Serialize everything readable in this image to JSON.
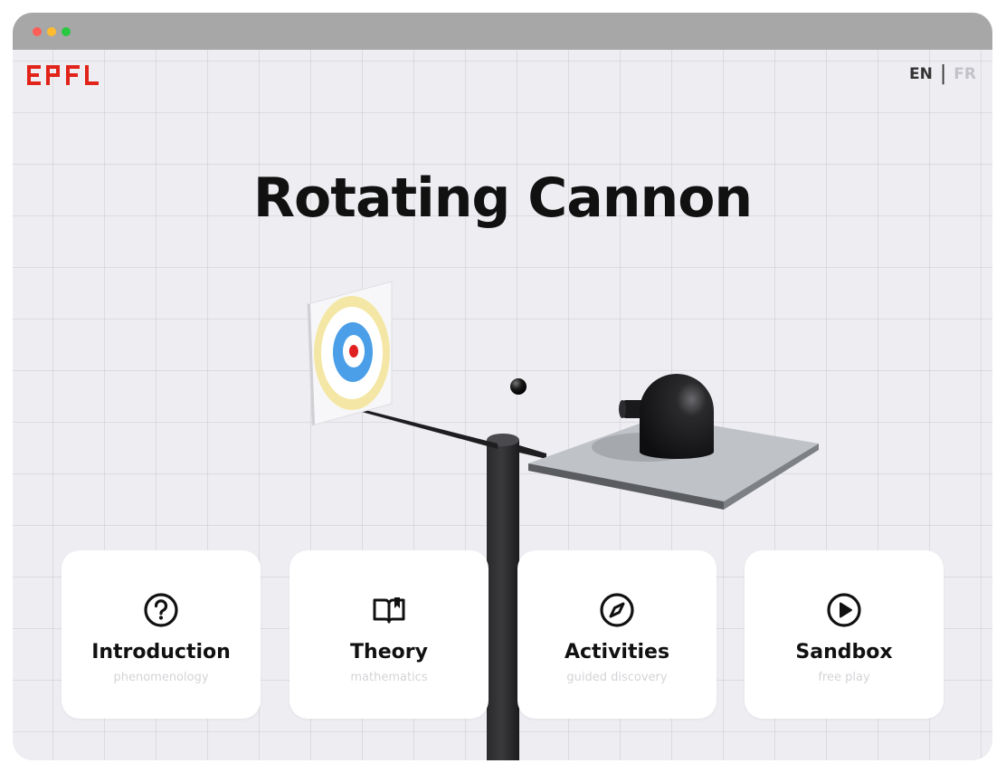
{
  "app": {
    "logo_text": "EPFL",
    "title": "Rotating Cannon"
  },
  "language": {
    "active": "EN",
    "separator": "|",
    "inactive": "FR"
  },
  "cards": [
    {
      "title": "Introduction",
      "subtitle": "phenomenology",
      "icon": "question-circle-icon"
    },
    {
      "title": "Theory",
      "subtitle": "mathematics",
      "icon": "open-book-icon"
    },
    {
      "title": "Activities",
      "subtitle": "guided discovery",
      "icon": "compass-icon"
    },
    {
      "title": "Sandbox",
      "subtitle": "free play",
      "icon": "play-circle-icon"
    }
  ],
  "colors": {
    "brand_red": "#e2231a",
    "background": "#eeeef2",
    "titlebar": "#a7a7a7",
    "target_outer": "#f4e7a6",
    "target_middle": "#4a9fe8",
    "target_center": "#e02020"
  }
}
